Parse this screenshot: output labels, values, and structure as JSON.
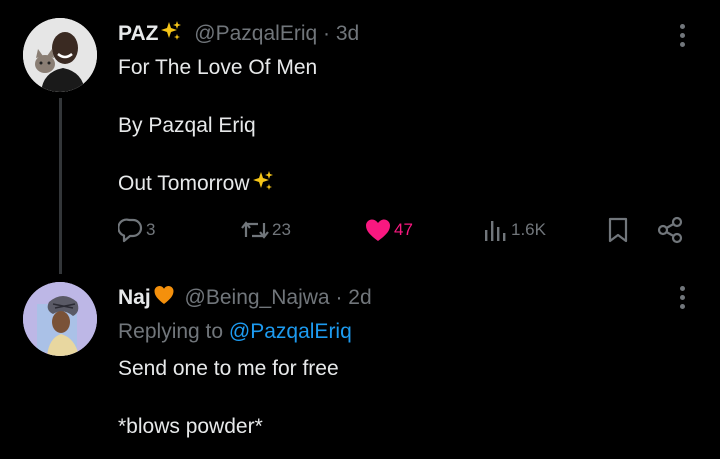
{
  "post": {
    "author_name": "PAZ",
    "author_handle": "@PazqalEriq",
    "separator": "·",
    "time": "3d",
    "lines": [
      "For The Love Of Men",
      "By Pazqal Eriq",
      "Out Tomorrow"
    ],
    "actions": {
      "replies": "3",
      "reposts": "23",
      "likes": "47",
      "views": "1.6K"
    },
    "like_color": "#f91880",
    "icons": [
      "sparkles-icon",
      "reply-icon",
      "repost-icon",
      "heart-icon",
      "views-icon",
      "bookmark-icon",
      "share-icon",
      "more-icon"
    ]
  },
  "reply": {
    "author_name": "Naj",
    "author_handle": "@Being_Najwa",
    "separator": "·",
    "time": "2d",
    "replying_prefix": "Replying to",
    "replying_to": "@PazqalEriq",
    "lines": [
      "Send one to me for free",
      "*blows powder*"
    ],
    "icons": [
      "orange-heart-icon",
      "more-icon"
    ]
  },
  "colors": {
    "background": "#000000",
    "text": "#e7e9ea",
    "muted": "#71767b",
    "link": "#1d9bf0",
    "like": "#f91880"
  }
}
